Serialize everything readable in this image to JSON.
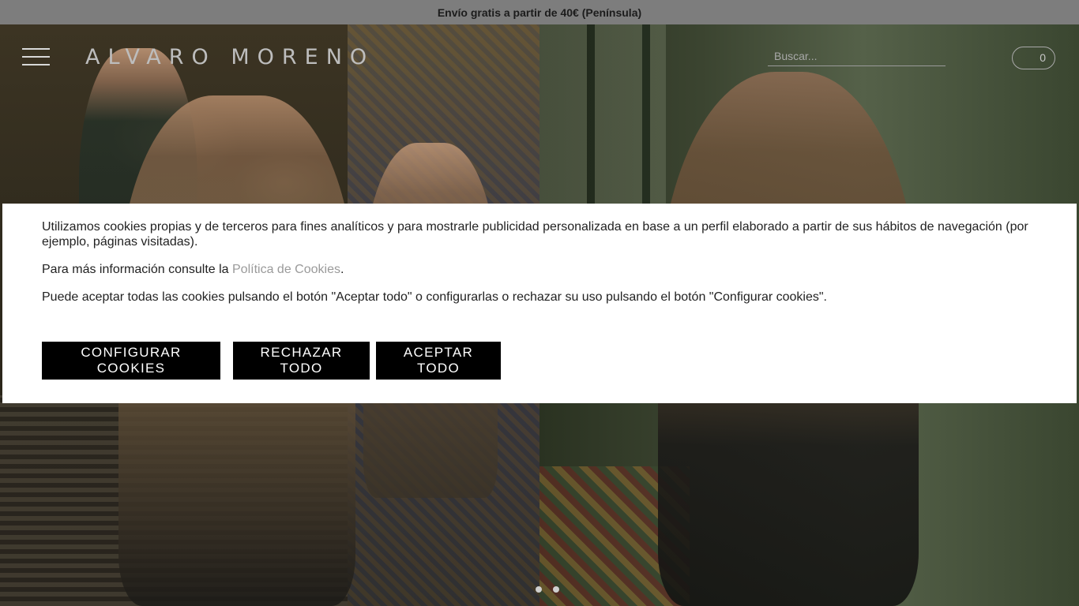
{
  "topbar": {
    "text": "Envío gratis a partir de 40€ (Península)"
  },
  "header": {
    "logo": "ALVARO MORENO",
    "menu_icon": "hamburger-menu-icon",
    "search": {
      "placeholder": "Buscar...",
      "value": ""
    },
    "cart": {
      "count": "0",
      "icon": "cart-icon"
    }
  },
  "hero": {
    "slides": 2
  },
  "cookie_banner": {
    "paragraph1": "Utilizamos cookies propias y de terceros para fines analíticos y para mostrarle publicidad personalizada en base a un perfil elaborado a partir de sus hábitos de navegación (por ejemplo, páginas visitadas).",
    "paragraph2_prefix": "Para más información consulte la ",
    "paragraph2_link": "Política de Cookies",
    "paragraph2_suffix": ".",
    "paragraph3": "Puede aceptar todas las cookies pulsando el botón \"Aceptar todo\" o configurarlas o rechazar su uso pulsando el botón \"Configurar cookies\".",
    "buttons": {
      "configure": "CONFIGURAR COOKIES",
      "reject": "RECHAZAR TODO",
      "accept": "ACEPTAR TODO"
    }
  },
  "colors": {
    "topbar_bg": "#7d7d7d",
    "button_bg": "#000000",
    "link": "#9a9a9a"
  }
}
